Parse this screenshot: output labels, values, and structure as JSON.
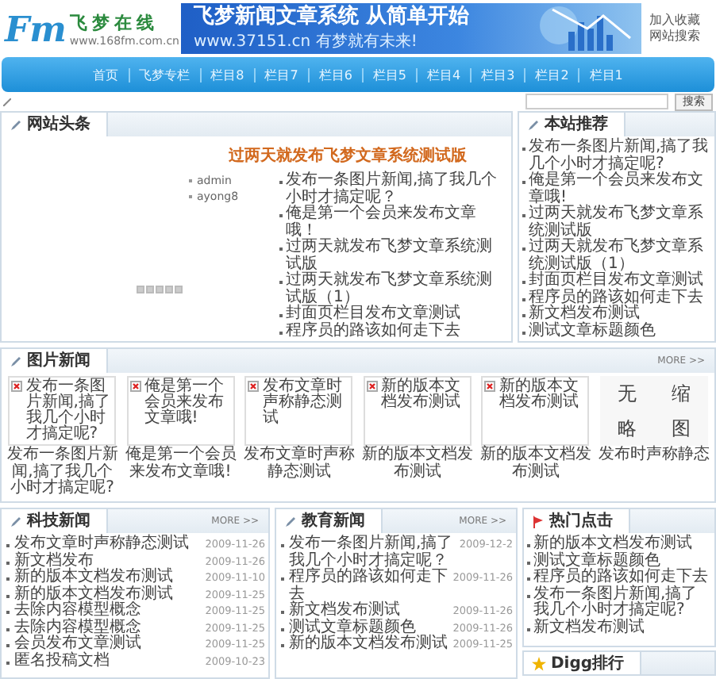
{
  "header": {
    "logo_mark": "Fm",
    "logo_title": "飞梦在线",
    "logo_url": "www.168fm.com.cn",
    "banner_title": "飞梦新闻文章系统 从简单开始",
    "banner_url": "www.37151.cn",
    "banner_slogan": "有梦就有未来!",
    "links": [
      "加入收藏",
      "网站搜索"
    ]
  },
  "nav": [
    "首页",
    "飞梦专栏",
    "栏目8",
    "栏目7",
    "栏目6",
    "栏目5",
    "栏目4",
    "栏目3",
    "栏目2",
    "栏目1"
  ],
  "search": {
    "button": "搜索"
  },
  "headline": {
    "title": "网站头条",
    "featured": "过两天就发布飞梦文章系统测试版",
    "authors": [
      "admin",
      "ayong8"
    ],
    "items": [
      "发布一条图片新闻,搞了我几个小时才搞定呢？",
      "俺是第一个会员来发布文章哦！",
      "过两天就发布飞梦文章系统测试版",
      "过两天就发布飞梦文章系统测试版（1）",
      "封面页栏目发布文章测试",
      "程序员的路该如何走下去"
    ]
  },
  "recommend": {
    "title": "本站推荐",
    "items": [
      "发布一条图片新闻,搞了我几个小时才搞定呢?",
      "俺是第一个会员来发布文章哦!",
      "过两天就发布飞梦文章系统测试版",
      "过两天就发布飞梦文章系统测试版（1）",
      "封面页栏目发布文章测试",
      "程序员的路该如何走下去",
      "新文档发布测试",
      "测试文章标题颜色"
    ]
  },
  "picture_news": {
    "title": "图片新闻",
    "more": "MORE >>",
    "items": [
      {
        "kind": "broken",
        "alt": "发布一条图片新闻,搞了我几个小时才搞定呢?",
        "caption": "发布一条图片新闻,搞了我几个小时才搞定呢?"
      },
      {
        "kind": "broken",
        "alt": "俺是第一个会员来发布文章哦!",
        "caption": "俺是第一个会员来发布文章哦!"
      },
      {
        "kind": "broken",
        "alt": "发布文章时声称静态测试",
        "caption": "发布文章时声称静态测试"
      },
      {
        "kind": "broken",
        "alt": "新的版本文档发布测试",
        "caption": "新的版本文档发布测试"
      },
      {
        "kind": "broken",
        "alt": "新的版本文档发布测试",
        "caption": "新的版本文档发布测试"
      },
      {
        "kind": "placeholder",
        "image_text": [
          "无",
          "缩",
          "略",
          "图"
        ],
        "caption": "发布时声称静态"
      }
    ]
  },
  "tech_news": {
    "title": "科技新闻",
    "more": "MORE >>",
    "items": [
      {
        "title": "发布文章时声称静态测试",
        "date": "2009-11-26"
      },
      {
        "title": "新文档发布",
        "date": "2009-11-26"
      },
      {
        "title": "新的版本文档发布测试",
        "date": "2009-11-10"
      },
      {
        "title": "新的版本文档发布测试",
        "date": "2009-11-25"
      },
      {
        "title": "去除内容模型概念",
        "date": "2009-11-25"
      },
      {
        "title": "去除内容模型概念",
        "date": "2009-11-25"
      },
      {
        "title": "会员发布文章测试",
        "date": "2009-11-25"
      },
      {
        "title": "匿名投稿文档",
        "date": "2009-10-23"
      }
    ]
  },
  "edu_news": {
    "title": "教育新闻",
    "more": "MORE >>",
    "items": [
      {
        "title": "发布一条图片新闻,搞了我几个小时才搞定呢？",
        "date": "2009-12-2"
      },
      {
        "title": "程序员的路该如何走下去",
        "date": "2009-11-26"
      },
      {
        "title": "新文档发布测试",
        "date": "2009-11-26"
      },
      {
        "title": "测试文章标题颜色",
        "date": "2009-11-26"
      },
      {
        "title": "新的版本文档发布测试",
        "date": "2009-11-25"
      }
    ]
  },
  "hot": {
    "title": "热门点击",
    "items": [
      "新的版本文档发布测试",
      "测试文章标题颜色",
      "程序员的路该如何走下去",
      "发布一条图片新闻,搞了我几个小时才搞定呢?",
      "新文档发布测试"
    ]
  },
  "digg": {
    "title": "Digg排行"
  }
}
